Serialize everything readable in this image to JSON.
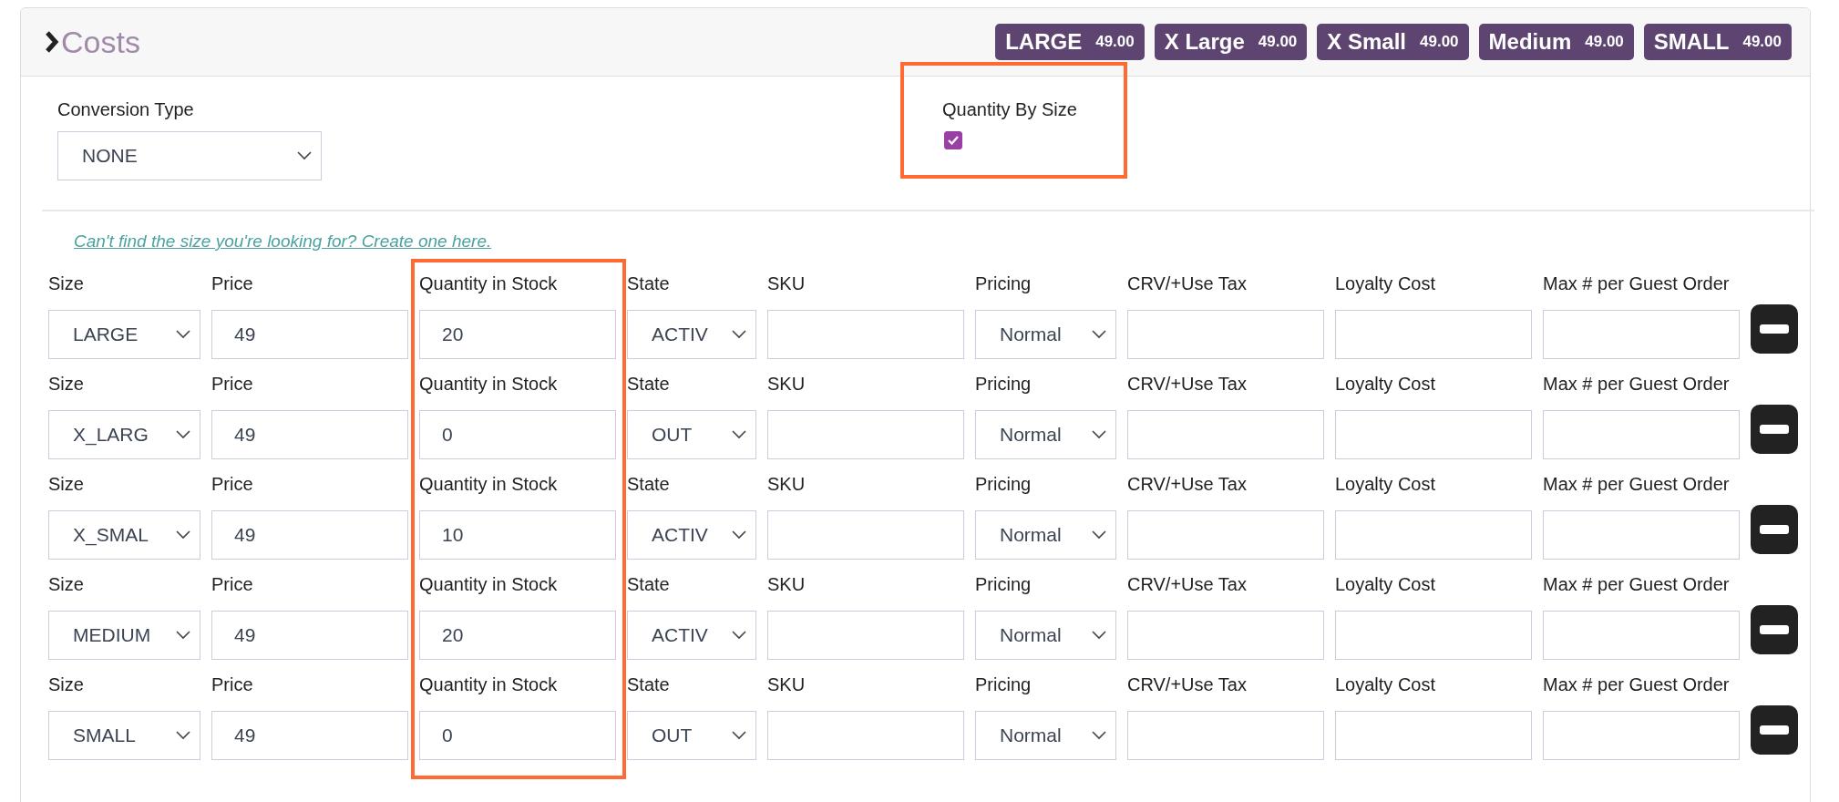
{
  "header": {
    "title": "Costs",
    "badges": [
      {
        "name": "LARGE",
        "price": "49.00"
      },
      {
        "name": "X Large",
        "price": "49.00"
      },
      {
        "name": "X Small",
        "price": "49.00"
      },
      {
        "name": "Medium",
        "price": "49.00"
      },
      {
        "name": "SMALL",
        "price": "49.00"
      }
    ]
  },
  "conversion": {
    "label": "Conversion Type",
    "value": "NONE"
  },
  "quantity_by_size": {
    "label": "Quantity By Size",
    "checked": true,
    "highlighted": true
  },
  "create_link": "Can't find the size you're looking for? Create one here.",
  "quantity_column_highlighted": true,
  "rows": [
    {
      "fields": [
        {
          "kind": "select",
          "label": "Size",
          "value": "LARGE"
        },
        {
          "kind": "input",
          "label": "Price",
          "value": "49"
        },
        {
          "kind": "input",
          "label": "Quantity in Stock",
          "value": "20"
        },
        {
          "kind": "select",
          "label": "State",
          "value": "ACTIV"
        },
        {
          "kind": "input",
          "label": "SKU"
        },
        {
          "kind": "select",
          "label": "Pricing",
          "value": "Normal"
        },
        {
          "kind": "input",
          "label": "CRV/+Use Tax"
        },
        {
          "kind": "input",
          "label": "Loyalty Cost"
        },
        {
          "kind": "input",
          "label": "Max # per Guest Order"
        }
      ]
    },
    {
      "fields": [
        {
          "kind": "select",
          "label": "Size",
          "value": "X_LARG"
        },
        {
          "kind": "input",
          "label": "Price",
          "value": "49"
        },
        {
          "kind": "input",
          "label": "Quantity in Stock",
          "value": "0"
        },
        {
          "kind": "select",
          "label": "State",
          "value": "OUT"
        },
        {
          "kind": "input",
          "label": "SKU"
        },
        {
          "kind": "select",
          "label": "Pricing",
          "value": "Normal"
        },
        {
          "kind": "input",
          "label": "CRV/+Use Tax"
        },
        {
          "kind": "input",
          "label": "Loyalty Cost"
        },
        {
          "kind": "input",
          "label": "Max # per Guest Order"
        }
      ]
    },
    {
      "fields": [
        {
          "kind": "select",
          "label": "Size",
          "value": "X_SMAL"
        },
        {
          "kind": "input",
          "label": "Price",
          "value": "49"
        },
        {
          "kind": "input",
          "label": "Quantity in Stock",
          "value": "10"
        },
        {
          "kind": "select",
          "label": "State",
          "value": "ACTIV"
        },
        {
          "kind": "input",
          "label": "SKU"
        },
        {
          "kind": "select",
          "label": "Pricing",
          "value": "Normal"
        },
        {
          "kind": "input",
          "label": "CRV/+Use Tax"
        },
        {
          "kind": "input",
          "label": "Loyalty Cost"
        },
        {
          "kind": "input",
          "label": "Max # per Guest Order"
        }
      ]
    },
    {
      "fields": [
        {
          "kind": "select",
          "label": "Size",
          "value": "MEDIUM"
        },
        {
          "kind": "input",
          "label": "Price",
          "value": "49"
        },
        {
          "kind": "input",
          "label": "Quantity in Stock",
          "value": "20"
        },
        {
          "kind": "select",
          "label": "State",
          "value": "ACTIV"
        },
        {
          "kind": "input",
          "label": "SKU"
        },
        {
          "kind": "select",
          "label": "Pricing",
          "value": "Normal"
        },
        {
          "kind": "input",
          "label": "CRV/+Use Tax"
        },
        {
          "kind": "input",
          "label": "Loyalty Cost"
        },
        {
          "kind": "input",
          "label": "Max # per Guest Order"
        }
      ]
    },
    {
      "fields": [
        {
          "kind": "select",
          "label": "Size",
          "value": "SMALL"
        },
        {
          "kind": "input",
          "label": "Price",
          "value": "49"
        },
        {
          "kind": "input",
          "label": "Quantity in Stock",
          "value": "0"
        },
        {
          "kind": "select",
          "label": "State",
          "value": "OUT"
        },
        {
          "kind": "input",
          "label": "SKU"
        },
        {
          "kind": "select",
          "label": "Pricing",
          "value": "Normal"
        },
        {
          "kind": "input",
          "label": "CRV/+Use Tax"
        },
        {
          "kind": "input",
          "label": "Loyalty Cost"
        },
        {
          "kind": "input",
          "label": "Max # per Guest Order"
        }
      ]
    }
  ]
}
